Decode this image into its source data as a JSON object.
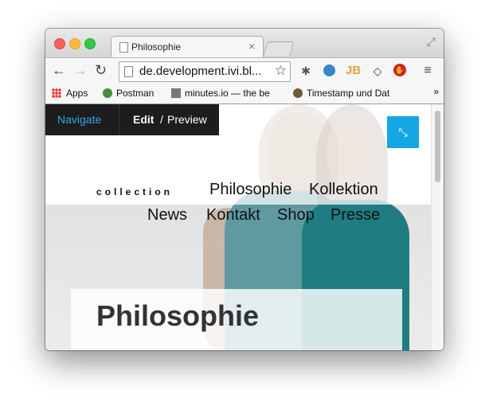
{
  "browser": {
    "tab_title": "Philosophie",
    "tab_close": "×",
    "url": "de.development.ivi.bl...",
    "extensions": [
      {
        "name": "bug-icon",
        "glyph": "✱"
      },
      {
        "name": "globe-icon",
        "glyph": ""
      },
      {
        "name": "jb-icon",
        "glyph": "JB"
      },
      {
        "name": "tag-icon",
        "glyph": "◇"
      },
      {
        "name": "stop-icon",
        "glyph": "✋"
      }
    ],
    "bookmarks": [
      {
        "label": "Apps"
      },
      {
        "label": "Postman"
      },
      {
        "label": "minutes.io — the be"
      },
      {
        "label": "Timestamp und Dat"
      }
    ],
    "bookmarks_more": "»"
  },
  "admin": {
    "navigate": "Navigate",
    "edit": "Edit",
    "slash": "/",
    "preview": "Preview"
  },
  "site": {
    "logo_text": "collection",
    "nav": [
      "Philosophie",
      "Kollektion",
      "News",
      "Kontakt",
      "Shop",
      "Presse"
    ],
    "page_title": "Philosophie"
  },
  "colors": {
    "accent": "#13a7e4",
    "admin_bar": "#1d1d1d"
  }
}
